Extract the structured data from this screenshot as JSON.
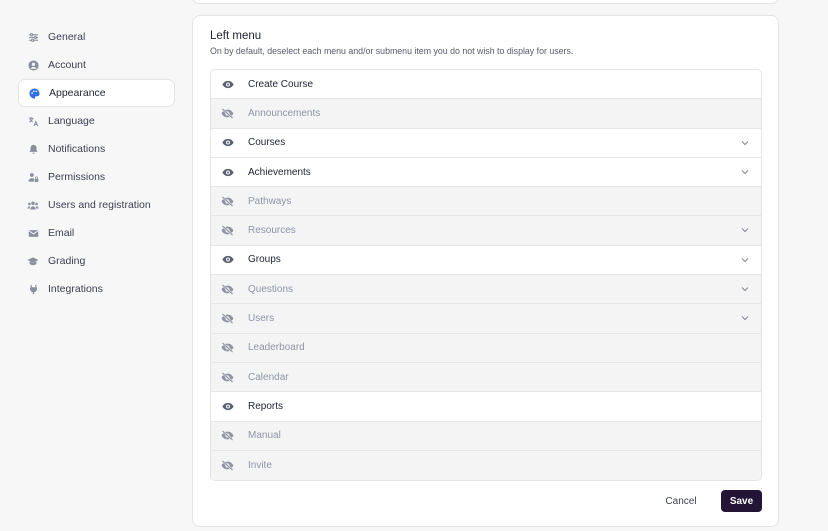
{
  "sidebar": {
    "items": [
      {
        "label": "General",
        "icon": "sliders-icon",
        "active": false
      },
      {
        "label": "Account",
        "icon": "user-circle-icon",
        "active": false
      },
      {
        "label": "Appearance",
        "icon": "palette-icon",
        "active": true
      },
      {
        "label": "Language",
        "icon": "translate-icon",
        "active": false
      },
      {
        "label": "Notifications",
        "icon": "bell-icon",
        "active": false
      },
      {
        "label": "Permissions",
        "icon": "user-lock-icon",
        "active": false
      },
      {
        "label": "Users and registration",
        "icon": "users-icon",
        "active": false
      },
      {
        "label": "Email",
        "icon": "envelope-icon",
        "active": false
      },
      {
        "label": "Grading",
        "icon": "graduation-cap-icon",
        "active": false
      },
      {
        "label": "Integrations",
        "icon": "plug-icon",
        "active": false
      }
    ]
  },
  "panel": {
    "title": "Left menu",
    "subtitle": "On by default, deselect each menu and/or submenu item you do not wish to display for users.",
    "items": [
      {
        "label": "Create Course",
        "visible": true,
        "expandable": false
      },
      {
        "label": "Announcements",
        "visible": false,
        "expandable": false
      },
      {
        "label": "Courses",
        "visible": true,
        "expandable": true
      },
      {
        "label": "Achievements",
        "visible": true,
        "expandable": true
      },
      {
        "label": "Pathways",
        "visible": false,
        "expandable": false
      },
      {
        "label": "Resources",
        "visible": false,
        "expandable": true
      },
      {
        "label": "Groups",
        "visible": true,
        "expandable": true
      },
      {
        "label": "Questions",
        "visible": false,
        "expandable": true
      },
      {
        "label": "Users",
        "visible": false,
        "expandable": true
      },
      {
        "label": "Leaderboard",
        "visible": false,
        "expandable": false
      },
      {
        "label": "Calendar",
        "visible": false,
        "expandable": false
      },
      {
        "label": "Reports",
        "visible": true,
        "expandable": false
      },
      {
        "label": "Manual",
        "visible": false,
        "expandable": false
      },
      {
        "label": "Invite",
        "visible": false,
        "expandable": false
      }
    ]
  },
  "actions": {
    "cancel_label": "Cancel",
    "save_label": "Save"
  },
  "colors": {
    "accent": "#2f6fe4",
    "save_button": "#241536",
    "hidden_row_bg": "#f4f4f5"
  }
}
